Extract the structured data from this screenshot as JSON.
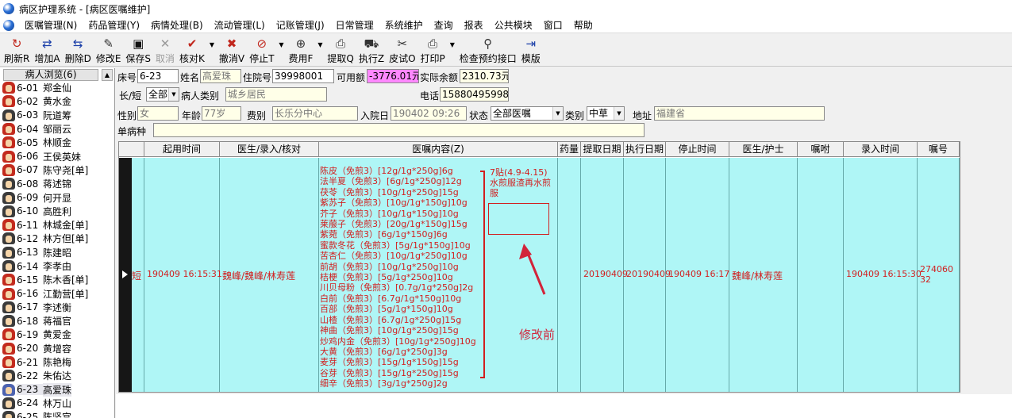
{
  "window": {
    "title": "病区护理系统 - [病区医嘱维护]"
  },
  "menu": [
    "医嘱管理(N)",
    "药品管理(Y)",
    "病情处理(B)",
    "流动管理(L)",
    "记账管理(J)",
    "日常管理",
    "系统维护",
    "查询",
    "报表",
    "公共模块",
    "窗口",
    "帮助"
  ],
  "toolbar": [
    {
      "label": "刷新R",
      "icon": "refresh-icon",
      "glyph": "↻",
      "color": "#c1271d",
      "disabled": false
    },
    {
      "label": "增加A",
      "icon": "add-arrows-icon",
      "glyph": "⇄",
      "color": "#1b3fa8",
      "disabled": false
    },
    {
      "label": "删除D",
      "icon": "delete-arrows-icon",
      "glyph": "⇆",
      "color": "#1b3fa8",
      "disabled": false
    },
    {
      "label": "修改E",
      "icon": "edit-doc-icon",
      "glyph": "✎",
      "color": "#333",
      "disabled": false
    },
    {
      "label": "保存S",
      "icon": "save-disk-icon",
      "glyph": "▣",
      "color": "#111",
      "disabled": false
    },
    {
      "label": "取消",
      "icon": "cancel-x-icon",
      "glyph": "✕",
      "color": "#999",
      "disabled": true
    },
    {
      "label": "核对K",
      "icon": "check-mark-icon",
      "glyph": "✔",
      "color": "#c1271d",
      "disabled": false,
      "dropdown": true
    },
    {
      "label": "撤消V",
      "icon": "undo-x-icon",
      "glyph": "✖",
      "color": "#c1271d",
      "disabled": false
    },
    {
      "label": "停止T",
      "icon": "stop-circle-icon",
      "glyph": "⊘",
      "color": "#c1271d",
      "disabled": false,
      "dropdown": true
    },
    {
      "label": "费用F",
      "icon": "zoom-cost-icon",
      "glyph": "⊕",
      "color": "#333",
      "disabled": false,
      "dropdown": true
    },
    {
      "label": "提取Q",
      "icon": "extract-printer-icon",
      "glyph": "⎙",
      "color": "#333",
      "disabled": false
    },
    {
      "label": "执行Z",
      "icon": "execute-car-icon",
      "glyph": "⛟",
      "color": "#333",
      "disabled": false
    },
    {
      "label": "皮试O",
      "icon": "skin-test-icon",
      "glyph": "✂",
      "color": "#333",
      "disabled": false
    },
    {
      "label": "打印P",
      "icon": "print-icon",
      "glyph": "⎙",
      "color": "#333",
      "disabled": false,
      "dropdown": true
    },
    {
      "label": "检查预约接口",
      "icon": "inspect-search-icon",
      "glyph": "⚲",
      "color": "#333",
      "disabled": false
    },
    {
      "label": "模版",
      "icon": "template-door-icon",
      "glyph": "⇥",
      "color": "#1b3fa8",
      "disabled": false
    }
  ],
  "patient_list": {
    "header": "病人浏览(6)",
    "items": [
      {
        "bed": "6-01",
        "name": "郑金仙",
        "g": "f"
      },
      {
        "bed": "6-02",
        "name": "黄水金",
        "g": "f"
      },
      {
        "bed": "6-03",
        "name": "阮道筹",
        "g": "m"
      },
      {
        "bed": "6-04",
        "name": "邹丽云",
        "g": "f"
      },
      {
        "bed": "6-05",
        "name": "林顺金",
        "g": "f"
      },
      {
        "bed": "6-06",
        "name": "王侯英妹",
        "g": "f"
      },
      {
        "bed": "6-07",
        "name": "陈守尧[单]",
        "g": "f"
      },
      {
        "bed": "6-08",
        "name": "蒋述锦",
        "g": "m"
      },
      {
        "bed": "6-09",
        "name": "何开显",
        "g": "m"
      },
      {
        "bed": "6-10",
        "name": "高胜利",
        "g": "m"
      },
      {
        "bed": "6-11",
        "name": "林城金[单]",
        "g": "f"
      },
      {
        "bed": "6-12",
        "name": "林方但[单]",
        "g": "m"
      },
      {
        "bed": "6-13",
        "name": "陈建昭",
        "g": "m"
      },
      {
        "bed": "6-14",
        "name": "李孝由",
        "g": "m"
      },
      {
        "bed": "6-15",
        "name": "陈木香[单]",
        "g": "f"
      },
      {
        "bed": "6-16",
        "name": "江勤营[单]",
        "g": "f"
      },
      {
        "bed": "6-17",
        "name": "李述衡",
        "g": "m"
      },
      {
        "bed": "6-18",
        "name": "蒋福官",
        "g": "m"
      },
      {
        "bed": "6-19",
        "name": "黄爱金",
        "g": "f"
      },
      {
        "bed": "6-20",
        "name": "黄增容",
        "g": "f"
      },
      {
        "bed": "6-21",
        "name": "陈艳梅",
        "g": "f"
      },
      {
        "bed": "6-22",
        "name": "朱佑达",
        "g": "m"
      },
      {
        "bed": "6-23",
        "name": "高爱珠",
        "g": "s",
        "selected": true
      },
      {
        "bed": "6-24",
        "name": "林万山",
        "g": "m"
      },
      {
        "bed": "6-25",
        "name": "陈坚宫",
        "g": "m"
      }
    ]
  },
  "form": {
    "bed_label": "床号",
    "bed": "6-23",
    "name_label": "姓名",
    "name": "高爱珠",
    "inpatient_no_label": "住院号",
    "inpatient_no": "39998001",
    "available_label": "可用额",
    "available": "-3776.01元",
    "actual_balance_label": "实际余额",
    "actual_balance": "2310.73元",
    "term_label": "长/短",
    "term": "全部",
    "patient_type_label": "病人类别",
    "patient_type": "城乡居民",
    "phone_label": "电话",
    "phone": "15880495998",
    "sex_label": "性别",
    "sex": "女",
    "age_label": "年龄",
    "age": "77岁",
    "fee_type_label": "费别",
    "fee_type": "长乐分中心",
    "admit_date_label": "入院日",
    "admit_date": "190402 09:26",
    "status_label": "状态",
    "status": "全部医嘱",
    "category_label": "类别",
    "category": "中草",
    "address_label": "地址",
    "address": "福建省",
    "single_disease_label": "单病种",
    "single_disease": ""
  },
  "grid": {
    "headers": [
      "起用时间",
      "医生/录入/核对",
      "医嘱内容(Z)",
      "药量",
      "提取日期",
      "执行日期",
      "停止时间",
      "医生/护士",
      "嘱咐",
      "录入时间",
      "嘱号"
    ],
    "row": {
      "type": "短",
      "start_time": "190409 16:15:31",
      "doctor": "魏峰/魏峰/林寿莲",
      "herbs": [
        "陈皮（免煎3）[12g/1g*250g]6g",
        "法半夏（免煎3）[6g/1g*250g]12g",
        "茯苓（免煎3）[10g/1g*250g]15g",
        "紫苏子（免煎3）[10g/1g*150g]10g",
        "芥子（免煎3）[10g/1g*150g]10g",
        "莱菔子（免煎3）[20g/1g*150g]15g",
        "紫菀（免煎3）[6g/1g*150g]6g",
        "蜜款冬花（免煎3）[5g/1g*150g]10g",
        "苦杏仁（免煎3）[10g/1g*250g]10g",
        "前胡（免煎3）[10g/1g*250g]10g",
        "桔梗（免煎3）[5g/1g*250g]10g",
        "川贝母粉（免煎3）[0.7g/1g*250g]2g",
        "白前（免煎3）[6.7g/1g*150g]10g",
        "百部（免煎3）[5g/1g*150g]10g",
        "山楂（免煎3）[6.7g/1g*250g]15g",
        "神曲（免煎3）[10g/1g*250g]15g",
        "炒鸡内金（免煎3）[10g/1g*250g]10g",
        "大黄（免煎3）[6g/1g*250g]3g",
        "麦芽（免煎3）[15g/1g*150g]15g",
        "谷芽（免煎3）[15g/1g*250g]15g",
        "细辛（免煎3）[3g/1g*250g]2g"
      ],
      "note": "7贴(4.9-4.15)水煎服渣再水煎服",
      "extract_date": "20190409",
      "exec_date": "20190409",
      "stop_time": "190409 16:17",
      "doctor_nurse": "魏峰/林寿莲",
      "entry_time": "190409 16:15:30",
      "order_no": "27406032"
    }
  },
  "annotation": {
    "text": "修改前",
    "color": "#d2243a"
  }
}
